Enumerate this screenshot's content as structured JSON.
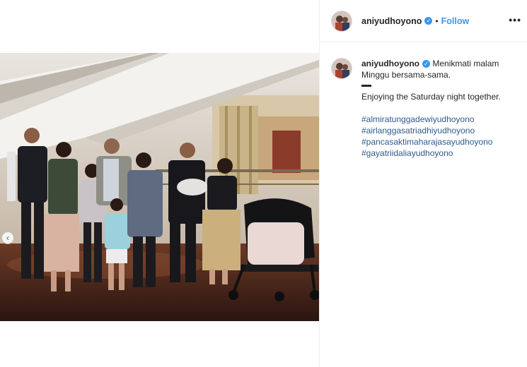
{
  "header": {
    "username": "aniyudhoyono",
    "verified_icon": "verified-badge-icon",
    "separator": "•",
    "follow_label": "Follow",
    "more_label": "•••"
  },
  "caption": {
    "username": "aniyudhoyono",
    "text_id": "Menikmati malam Minggu bersama-sama.",
    "text_en": "Enjoying the Saturday night together.",
    "hashtags": [
      "#almiratunggadewiyudhoyono",
      "#airlanggasatriadhiyudhoyono",
      "#pancasaktimaharajasayudhoyono",
      "#gayatriidaliayudhoyono"
    ]
  },
  "media": {
    "prev_icon": "chevron-left-icon",
    "prev_label": "‹"
  },
  "colors": {
    "accent": "#3897f0",
    "hashtag": "#2c5b8f"
  }
}
